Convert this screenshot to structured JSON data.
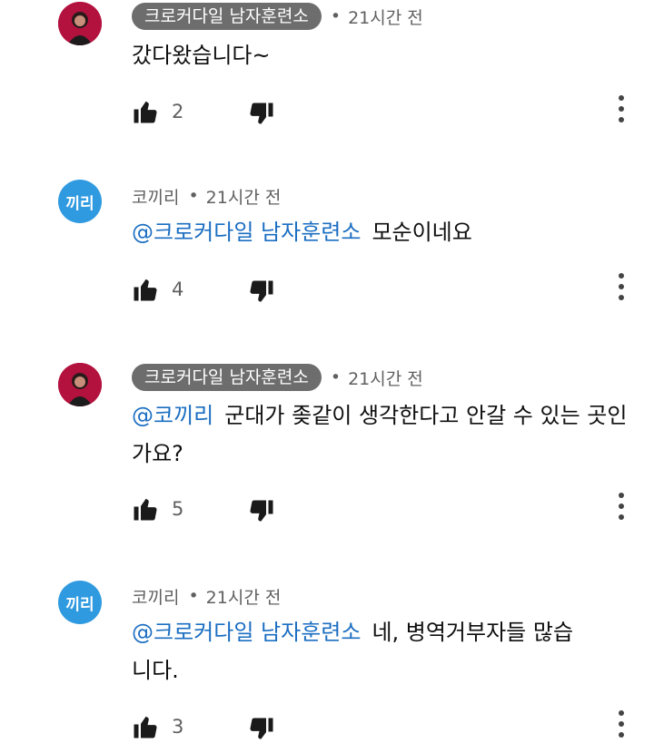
{
  "comments": [
    {
      "author": "크로커다일 남자훈련소",
      "time": "21시간 전",
      "mention": "",
      "text": "갔다왔습니다~",
      "likes": "2",
      "avatar_text": ""
    },
    {
      "author": "코끼리",
      "time": "21시간 전",
      "mention": "@크로커다일 남자훈련소",
      "text": "모순이네요",
      "likes": "4",
      "avatar_text": "끼리"
    },
    {
      "author": "크로커다일 남자훈련소",
      "time": "21시간 전",
      "mention": "@코끼리",
      "text": "군대가 좆같이 생각한다고 안갈 수 있는 곳인가요?",
      "likes": "5",
      "avatar_text": ""
    },
    {
      "author": "코끼리",
      "time": "21시간 전",
      "mention": "@크로커다일 남자훈련소",
      "text": "네, 병역거부자들 많습니다.",
      "likes": "3",
      "avatar_text": "끼리"
    }
  ],
  "colors": {
    "mention": "#1b6ec2",
    "author_chip": "#6d6d6d",
    "avatar_blue": "#2f9ae0",
    "avatar_red": "#b3123f"
  }
}
